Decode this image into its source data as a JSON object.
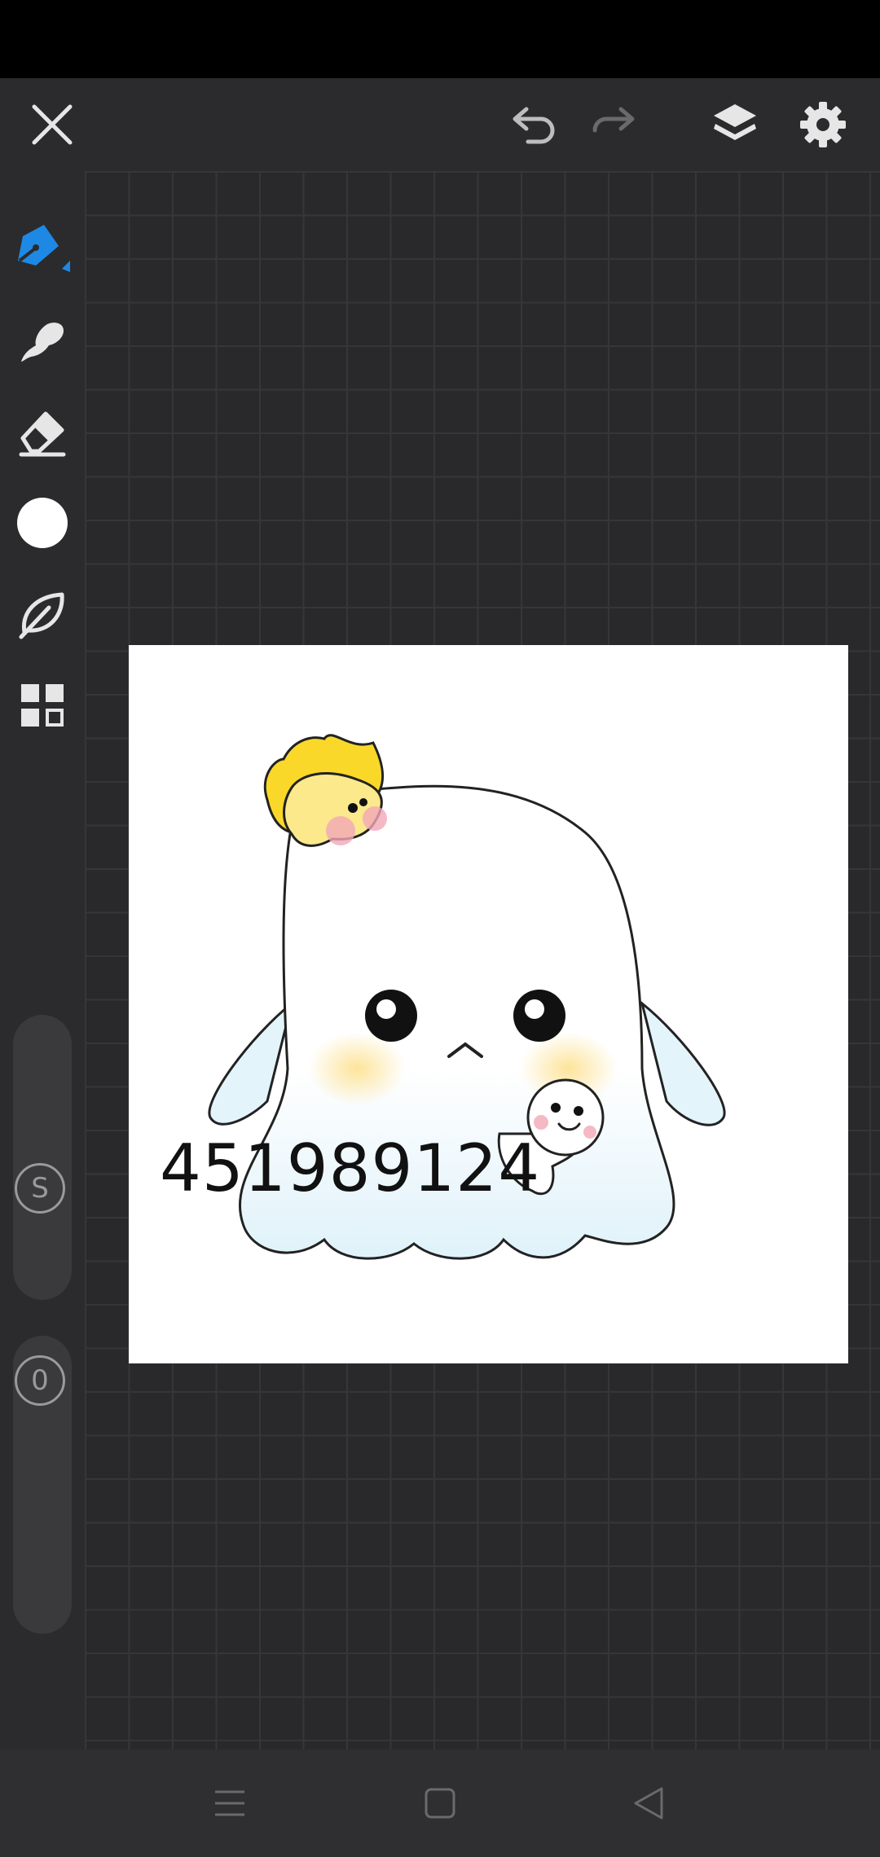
{
  "top_bar": {
    "icons": [
      "close-icon",
      "undo-icon",
      "redo-icon",
      "layers-icon",
      "settings-icon"
    ]
  },
  "left_toolbar": {
    "tools": [
      "pen-icon",
      "smudge-icon",
      "eraser-icon",
      "color-swatch",
      "leaf-brush-icon",
      "grid-menu-icon"
    ],
    "selected_tool": "pen",
    "current_color": "#ffffff",
    "size_label": "S",
    "opacity_label": "0"
  },
  "canvas": {
    "drawn_text": "451989124",
    "colors": {
      "ghost_body": "#ffffff",
      "ghost_bottom_tint": "#e3f4fb",
      "star_yellow": "#f9d82a",
      "face_yellow": "#fbe98b",
      "blush_pink": "#f3a8b6",
      "cheek_yellow": "#fce7a3"
    }
  },
  "nav_bar": {
    "icons": [
      "menu-icon",
      "home-icon",
      "back-icon"
    ]
  },
  "accent_color": "#1e88e5"
}
